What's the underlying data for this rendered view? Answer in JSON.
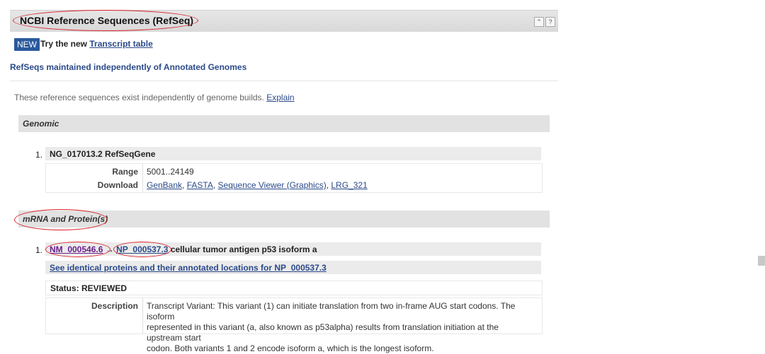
{
  "header": {
    "title": "NCBI Reference Sequences (RefSeq)",
    "ctrl_collapse": "⌃",
    "ctrl_help": "?"
  },
  "banner": {
    "badge": "NEW",
    "prefix": "Try the new",
    "link": "Transcript table"
  },
  "section": {
    "title": "RefSeqs maintained independently of Annotated Genomes",
    "intro": "These reference sequences exist independently of genome builds.",
    "intro_link": "Explain"
  },
  "genomic": {
    "heading": "Genomic",
    "item_number": "1.",
    "item_title": "NG_017013.2 RefSeqGene",
    "range_label": "Range",
    "range_value": "5001..24149",
    "download_label": "Download",
    "links": [
      "GenBank",
      "FASTA",
      "Sequence Viewer (Graphics)",
      "LRG_321"
    ]
  },
  "mrna": {
    "heading": "mRNA and Protein(s)",
    "item_number": "1.",
    "nm": "NM_000546.6",
    "dash": "→",
    "np": "NP_000537.3",
    "desc_title": "cellular tumor antigen p53 isoform a",
    "identical_link": "See identical proteins and their annotated locations for NP_000537.3",
    "status": "Status: REVIEWED",
    "description_label": "Description",
    "description_lines": [
      "Transcript Variant: This variant (1) can initiate translation from two in-frame AUG start codons. The isoform",
      "represented in this variant (a, also known as p53alpha) results from translation initiation at the upstream start",
      "codon. Both variants 1 and 2 encode isoform a, which is the longest isoform."
    ]
  },
  "colors": {
    "annotation": "#d9232b",
    "link": "#2b4a8a",
    "badge": "#2a5a9c"
  }
}
